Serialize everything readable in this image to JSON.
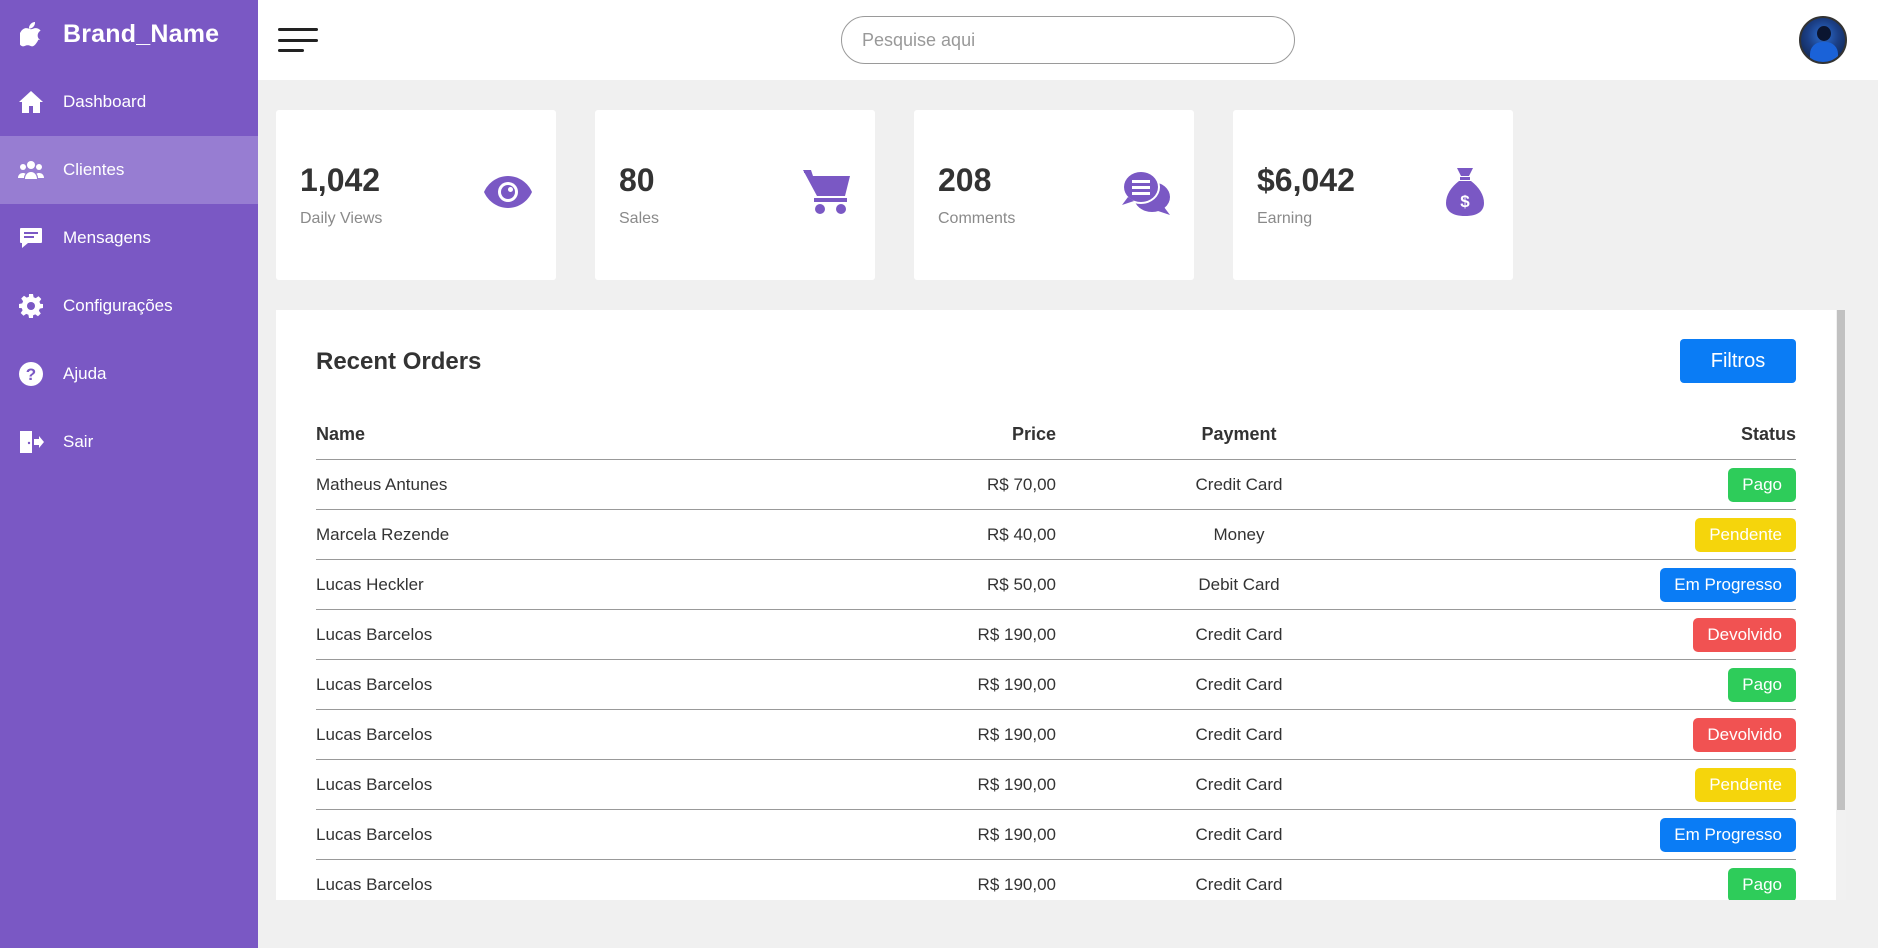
{
  "brand": {
    "name": "Brand_Name",
    "logo_icon": "apple-icon"
  },
  "sidebar": {
    "items": [
      {
        "label": "Dashboard",
        "icon": "home-icon",
        "active": false
      },
      {
        "label": "Clientes",
        "icon": "users-icon",
        "active": true
      },
      {
        "label": "Mensagens",
        "icon": "message-icon",
        "active": false
      },
      {
        "label": "Configurações",
        "icon": "gear-icon",
        "active": false
      },
      {
        "label": "Ajuda",
        "icon": "help-icon",
        "active": false
      },
      {
        "label": "Sair",
        "icon": "logout-icon",
        "active": false
      }
    ]
  },
  "topbar": {
    "search_placeholder": "Pesquise aqui",
    "menu_icon": "hamburger-icon",
    "avatar": "user-avatar"
  },
  "cards": [
    {
      "value": "1,042",
      "caption": "Daily Views",
      "icon": "eye-icon"
    },
    {
      "value": "80",
      "caption": "Sales",
      "icon": "cart-icon"
    },
    {
      "value": "208",
      "caption": "Comments",
      "icon": "comments-icon"
    },
    {
      "value": "$6,042",
      "caption": "Earning",
      "icon": "money-bag-icon"
    }
  ],
  "orders": {
    "title": "Recent Orders",
    "filter_label": "Filtros",
    "columns": {
      "name": "Name",
      "price": "Price",
      "payment": "Payment",
      "status": "Status"
    },
    "rows": [
      {
        "name": "Matheus Antunes",
        "price": "R$ 70,00",
        "payment": "Credit Card",
        "status": "Pago",
        "status_color": "#2ecc5a"
      },
      {
        "name": "Marcela Rezende",
        "price": "R$ 40,00",
        "payment": "Money",
        "status": "Pendente",
        "status_color": "#f5d50c"
      },
      {
        "name": "Lucas Heckler",
        "price": "R$ 50,00",
        "payment": "Debit Card",
        "status": "Em Progresso",
        "status_color": "#0a7cf5"
      },
      {
        "name": "Lucas Barcelos",
        "price": "R$ 190,00",
        "payment": "Credit Card",
        "status": "Devolvido",
        "status_color": "#f15252"
      },
      {
        "name": "Lucas Barcelos",
        "price": "R$ 190,00",
        "payment": "Credit Card",
        "status": "Pago",
        "status_color": "#2ecc5a"
      },
      {
        "name": "Lucas Barcelos",
        "price": "R$ 190,00",
        "payment": "Credit Card",
        "status": "Devolvido",
        "status_color": "#f15252"
      },
      {
        "name": "Lucas Barcelos",
        "price": "R$ 190,00",
        "payment": "Credit Card",
        "status": "Pendente",
        "status_color": "#f5d50c"
      },
      {
        "name": "Lucas Barcelos",
        "price": "R$ 190,00",
        "payment": "Credit Card",
        "status": "Em Progresso",
        "status_color": "#0a7cf5"
      },
      {
        "name": "Lucas Barcelos",
        "price": "R$ 190,00",
        "payment": "Credit Card",
        "status": "Pago",
        "status_color": "#2ecc5a"
      }
    ]
  },
  "colors": {
    "sidebar": "#7a58c4",
    "sidebar_active": "#977dd2",
    "accent": "#7a58c4",
    "primary_button": "#0a7cf5"
  }
}
